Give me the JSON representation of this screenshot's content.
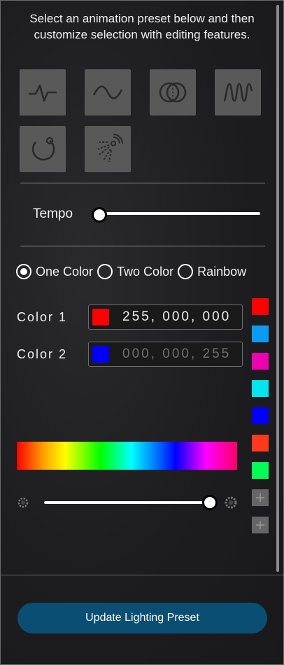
{
  "intro_text": "Select an animation preset below and then customize selection with editing features.",
  "presets": [
    {
      "icon": "pulse-icon"
    },
    {
      "icon": "wave-icon"
    },
    {
      "icon": "overlap-circles-icon"
    },
    {
      "icon": "oscillate-icon"
    },
    {
      "icon": "rotate-icon"
    },
    {
      "icon": "burst-icon"
    }
  ],
  "tempo": {
    "label": "Tempo",
    "value": 0.0
  },
  "color_mode": {
    "options": [
      "One Color",
      "Two Color",
      "Rainbow"
    ],
    "selected": "One Color"
  },
  "colors": [
    {
      "label": "Color 1",
      "value": "255, 000, 000",
      "hex": "#ff0000",
      "active": true
    },
    {
      "label": "Color 2",
      "value": "000, 000, 255",
      "hex": "#0000ff",
      "active": false
    }
  ],
  "swatches": [
    "#ff0000",
    "#0a9cf0",
    "#ee00b0",
    "#00e5ee",
    "#0000ff",
    "#ff3a1c",
    "#00ff55"
  ],
  "brightness": {
    "value": 1.0
  },
  "update_button": "Update Lighting Preset"
}
